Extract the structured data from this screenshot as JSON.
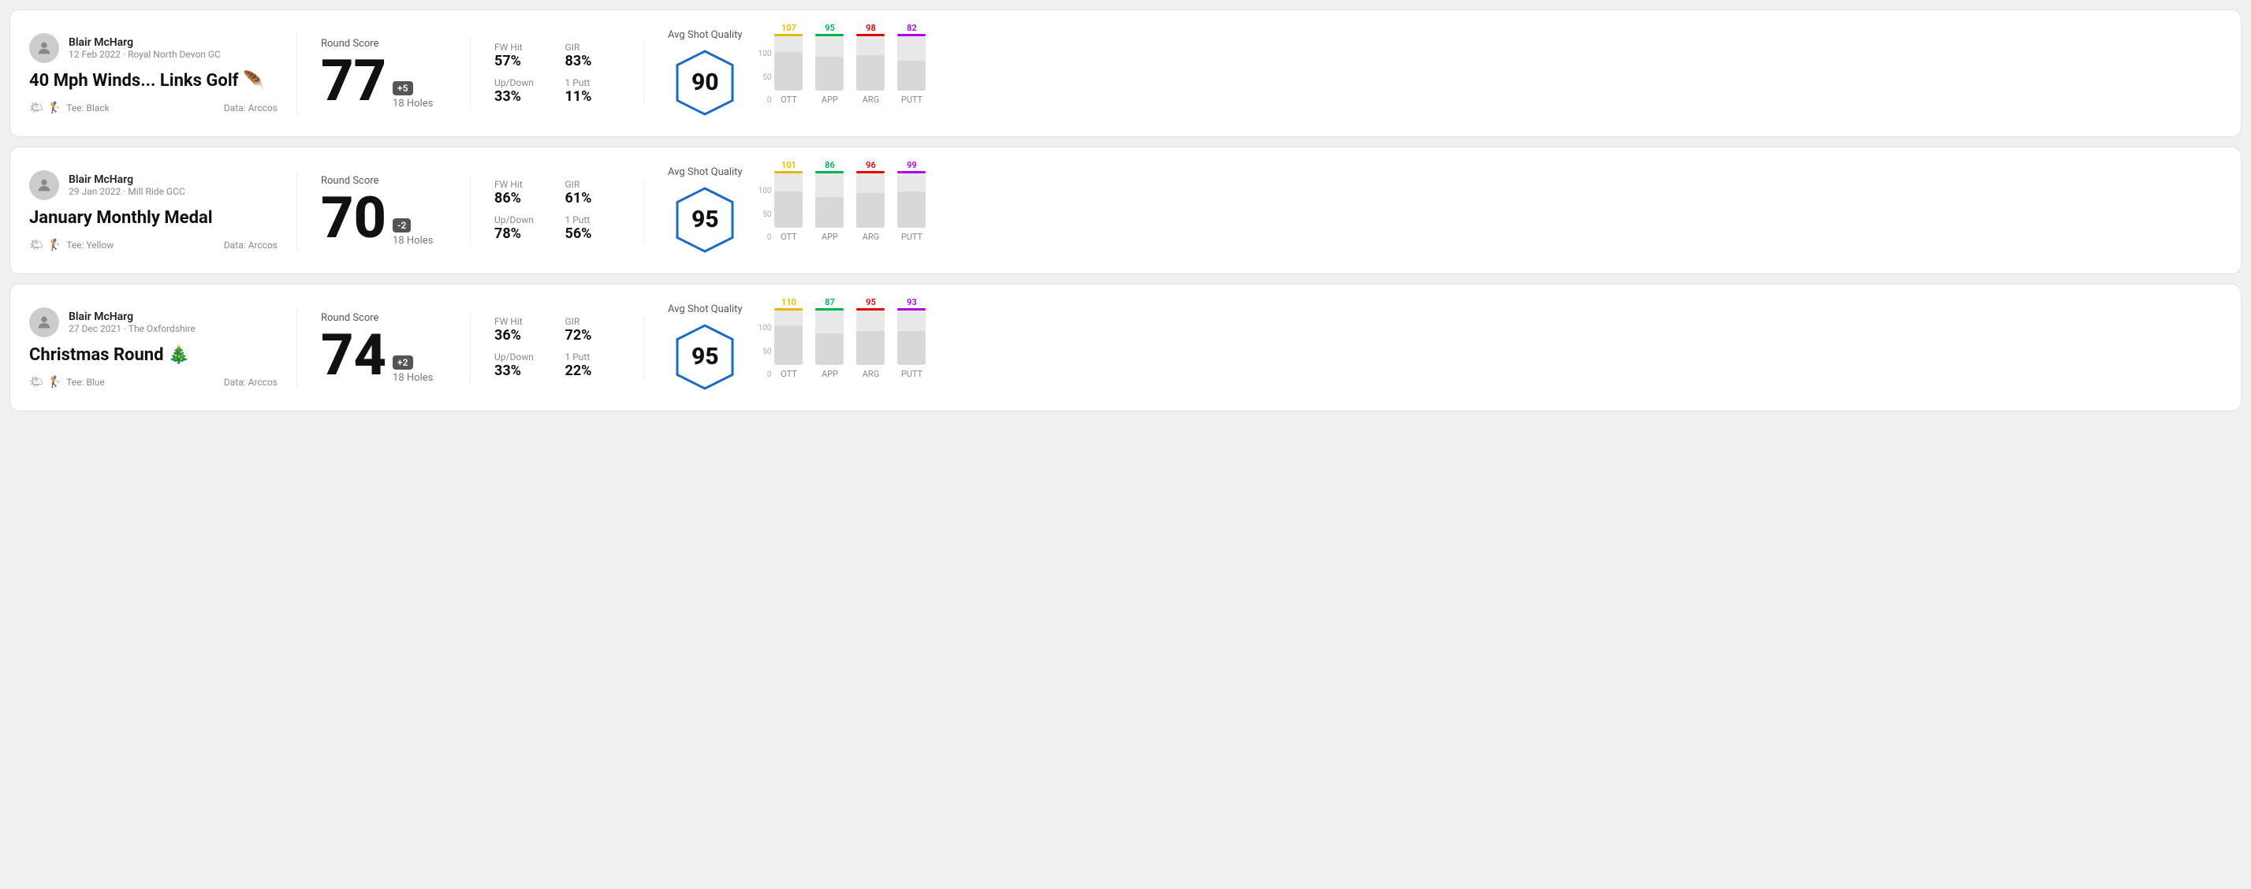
{
  "rounds": [
    {
      "id": "round-1",
      "user_name": "Blair McHarg",
      "user_meta": "12 Feb 2022 · Royal North Devon GC",
      "title": "40 Mph Winds... Links Golf 🪶",
      "tee": "Tee: Black",
      "data_source": "Data: Arccos",
      "score": "77",
      "score_badge": "+5",
      "holes": "18 Holes",
      "fw_hit": "57%",
      "gir": "83%",
      "up_down": "33%",
      "one_putt": "11%",
      "avg_shot_quality": "90",
      "chart": {
        "bars": [
          {
            "label": "OTT",
            "value": 107,
            "color": "#e6b800",
            "fill_pct": 70
          },
          {
            "label": "APP",
            "value": 95,
            "color": "#00b050",
            "fill_pct": 62
          },
          {
            "label": "ARG",
            "value": 98,
            "color": "#e60000",
            "fill_pct": 64
          },
          {
            "label": "PUTT",
            "value": 82,
            "color": "#b000e6",
            "fill_pct": 54
          }
        ]
      }
    },
    {
      "id": "round-2",
      "user_name": "Blair McHarg",
      "user_meta": "29 Jan 2022 · Mill Ride GCC",
      "title": "January Monthly Medal",
      "tee": "Tee: Yellow",
      "data_source": "Data: Arccos",
      "score": "70",
      "score_badge": "-2",
      "holes": "18 Holes",
      "fw_hit": "86%",
      "gir": "61%",
      "up_down": "78%",
      "one_putt": "56%",
      "avg_shot_quality": "95",
      "chart": {
        "bars": [
          {
            "label": "OTT",
            "value": 101,
            "color": "#e6b800",
            "fill_pct": 66
          },
          {
            "label": "APP",
            "value": 86,
            "color": "#00b050",
            "fill_pct": 56
          },
          {
            "label": "ARG",
            "value": 96,
            "color": "#e60000",
            "fill_pct": 63
          },
          {
            "label": "PUTT",
            "value": 99,
            "color": "#b000e6",
            "fill_pct": 65
          }
        ]
      }
    },
    {
      "id": "round-3",
      "user_name": "Blair McHarg",
      "user_meta": "27 Dec 2021 · The Oxfordshire",
      "title": "Christmas Round 🎄",
      "tee": "Tee: Blue",
      "data_source": "Data: Arccos",
      "score": "74",
      "score_badge": "+2",
      "holes": "18 Holes",
      "fw_hit": "36%",
      "gir": "72%",
      "up_down": "33%",
      "one_putt": "22%",
      "avg_shot_quality": "95",
      "chart": {
        "bars": [
          {
            "label": "OTT",
            "value": 110,
            "color": "#e6b800",
            "fill_pct": 72
          },
          {
            "label": "APP",
            "value": 87,
            "color": "#00b050",
            "fill_pct": 57
          },
          {
            "label": "ARG",
            "value": 95,
            "color": "#e60000",
            "fill_pct": 62
          },
          {
            "label": "PUTT",
            "value": 93,
            "color": "#b000e6",
            "fill_pct": 61
          }
        ]
      }
    }
  ],
  "labels": {
    "round_score": "Round Score",
    "fw_hit": "FW Hit",
    "gir": "GIR",
    "up_down": "Up/Down",
    "one_putt": "1 Putt",
    "avg_shot_quality": "Avg Shot Quality",
    "y_100": "100",
    "y_50": "50",
    "y_0": "0"
  }
}
